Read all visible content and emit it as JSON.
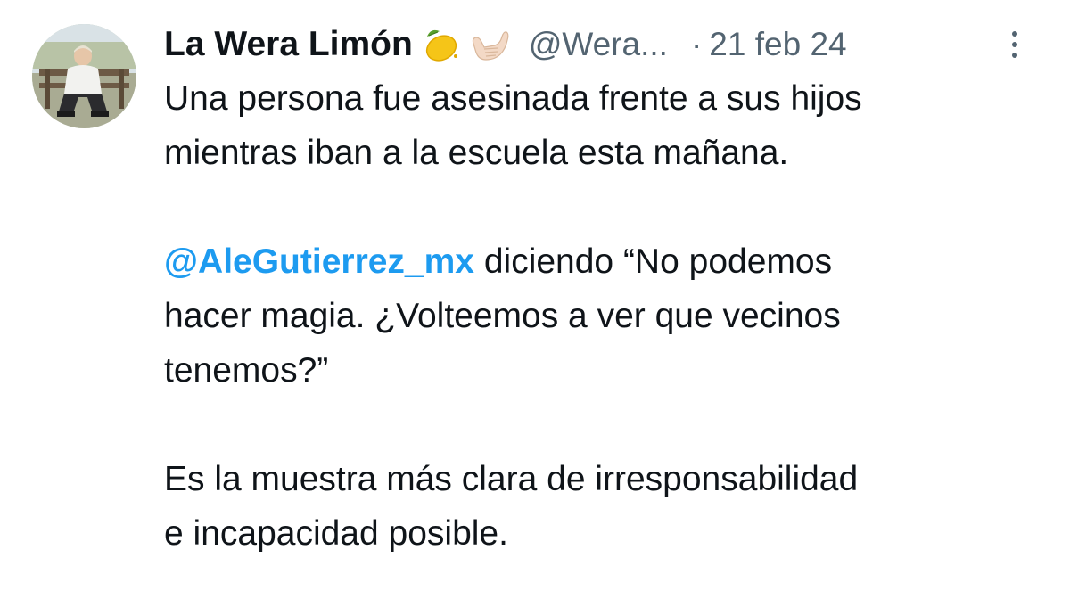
{
  "author": {
    "display_name": "La Wera Limón",
    "emojis": [
      "lemon-emoji",
      "call-me-hand-emoji"
    ],
    "handle": "@Wera...",
    "separator": "·",
    "date": "21 feb 24"
  },
  "tweet": {
    "paragraph1": {
      "line1": "Una persona fue asesinada frente a sus hijos",
      "line2": "mientras iban a la escuela esta mañana."
    },
    "paragraph2": {
      "mention": "@AleGutierrez_mx",
      "line1_rest": " diciendo “No podemos",
      "line2": "hacer magia. ¿Volteemos a ver que vecinos",
      "line3": "tenemos?”"
    },
    "paragraph3": {
      "line1": "Es la muestra más clara de irresponsabilidad",
      "line2": "e incapacidad posible."
    }
  },
  "colors": {
    "text": "#0f1419",
    "secondary": "#536471",
    "link": "#1d9bf0"
  },
  "icons": {
    "more": "more-vertical-icon"
  }
}
